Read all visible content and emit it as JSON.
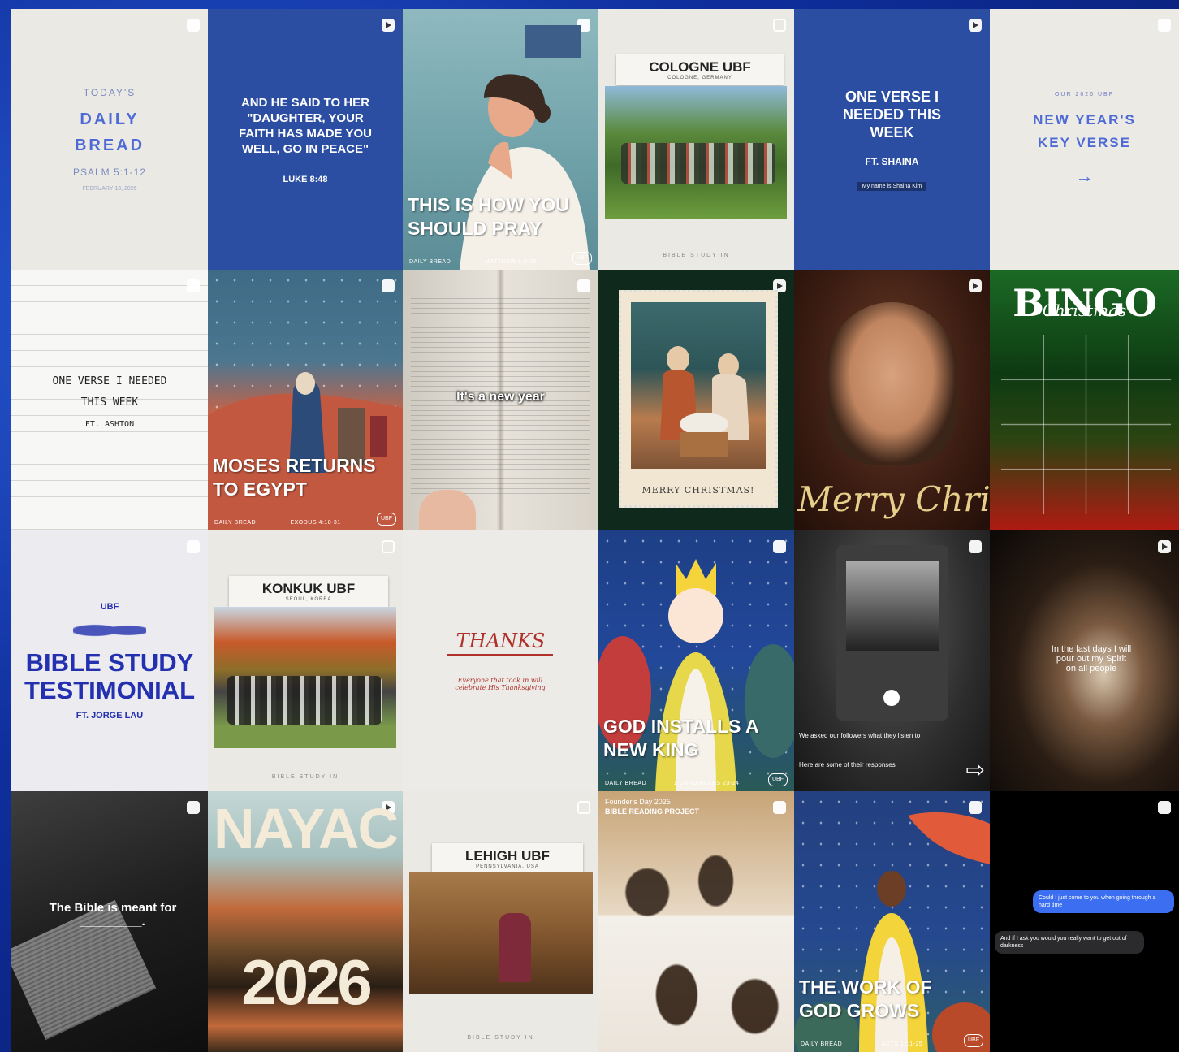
{
  "tiles": {
    "t1": {
      "kicker": "TODAY'S",
      "title1": "DAILY",
      "title2": "BREAD",
      "ref": "PSALM 5:1-12",
      "date": "FEBRUARY 13, 2026"
    },
    "t2": {
      "quote": "AND HE SAID TO HER \"DAUGHTER, YOUR FAITH HAS MADE YOU WELL, GO IN PEACE\"",
      "ref": "LUKE 8:48"
    },
    "t3": {
      "title": "THIS IS HOW YOU SHOULD PRAY",
      "footer_left": "DAILY BREAD",
      "footer_mid": "MATTHEW 6:9-15",
      "logo": "UBF"
    },
    "t4": {
      "title": "COLOGNE UBF",
      "subtitle": "COLOGNE, GERMANY",
      "footer": "BIBLE STUDY IN"
    },
    "t5": {
      "title": "ONE VERSE I NEEDED THIS WEEK",
      "ft": "FT. SHAINA",
      "caption": "My name is Shaina Kim"
    },
    "t6": {
      "kicker": "OUR 2026 UBF",
      "title": "NEW YEAR'S KEY VERSE",
      "arrow": "→"
    },
    "t7": {
      "title1": "ONE VERSE I NEEDED",
      "title2": "THIS WEEK",
      "ft": "FT. ASHTON"
    },
    "t8": {
      "title": "MOSES RETURNS TO EGYPT",
      "footer_left": "DAILY BREAD",
      "footer_mid": "EXODUS 4:18-31",
      "logo": "UBF"
    },
    "t9": {
      "caption": "It's a new year"
    },
    "t10": {
      "caption": "MERRY CHRISTMAS!"
    },
    "t11": {
      "caption": "Merry Christmas"
    },
    "t12": {
      "title": "BINGO",
      "script": "Christmas"
    },
    "t13": {
      "org": "UBF",
      "title1": "BIBLE STUDY",
      "title2": "TESTIMONIAL",
      "ft": "FT. JORGE LAU"
    },
    "t14": {
      "title": "KONKUK UBF",
      "subtitle": "SEOUL, KOREA",
      "footer": "BIBLE STUDY IN"
    },
    "t15": {
      "title": "THANKS",
      "note": "Everyone that took in will celebrate His Thanksgiving"
    },
    "t16": {
      "title": "GOD INSTALLS A NEW KING",
      "footer_left": "DAILY BREAD",
      "footer_mid": "1 CHRONICLES 23-24",
      "logo": "UBF"
    },
    "t17": {
      "caption": "We asked our followers what they listen to",
      "caption2": "Here are some of their responses"
    },
    "t18": {
      "caption": "In the last days I will pour out my Spirit on all people"
    },
    "t19": {
      "caption": "The Bible is meant for _________."
    },
    "t20": {
      "title": "NAYAC",
      "year": "2026"
    },
    "t21": {
      "title": "LEHIGH UBF",
      "subtitle": "PENNSYLVANIA, USA",
      "footer": "BIBLE STUDY IN"
    },
    "t22": {
      "kicker": "Founder's Day 2025",
      "title": "BIBLE READING PROJECT"
    },
    "t23": {
      "title": "THE WORK OF GOD GROWS",
      "footer_left": "DAILY BREAD",
      "footer_mid": "ACTS 12:1-25",
      "logo": "UBF"
    },
    "t24": {
      "msg1": "Could I just come to you when going through a hard time",
      "msg2": "And if I ask you would you really want to get out of darkness"
    }
  }
}
